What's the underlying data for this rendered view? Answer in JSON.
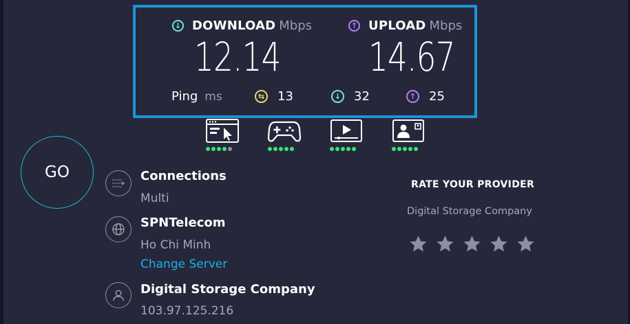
{
  "download": {
    "label": "DOWNLOAD",
    "unit": "Mbps",
    "value": "12.14"
  },
  "upload": {
    "label": "UPLOAD",
    "unit": "Mbps",
    "value": "14.67"
  },
  "ping": {
    "label": "Ping",
    "unit": "ms",
    "idle": "13",
    "download": "32",
    "upload": "25"
  },
  "quality": [
    {
      "name": "web-browsing-icon",
      "score": 4,
      "max": 5
    },
    {
      "name": "gaming-icon",
      "score": 5,
      "max": 5
    },
    {
      "name": "video-streaming-icon",
      "score": 5,
      "max": 5
    },
    {
      "name": "video-chat-icon",
      "score": 5,
      "max": 5
    }
  ],
  "go": {
    "label": "GO"
  },
  "connections": {
    "title": "Connections",
    "value": "Multi"
  },
  "server": {
    "title": "SPNTelecom",
    "location": "Ho Chi Minh",
    "change_label": "Change Server"
  },
  "provider": {
    "title": "Digital Storage Company",
    "ip": "103.97.125.216"
  },
  "rate": {
    "title": "RATE YOUR PROVIDER",
    "provider_name": "Digital Storage Company",
    "star_count": 5
  },
  "colors": {
    "accent_border": "#1b93d8",
    "download": "#72e7d2",
    "upload": "#b47dfd",
    "ping_idle": "#e9d66d",
    "link": "#1ab1e8",
    "good_dot": "#3fe07a"
  }
}
